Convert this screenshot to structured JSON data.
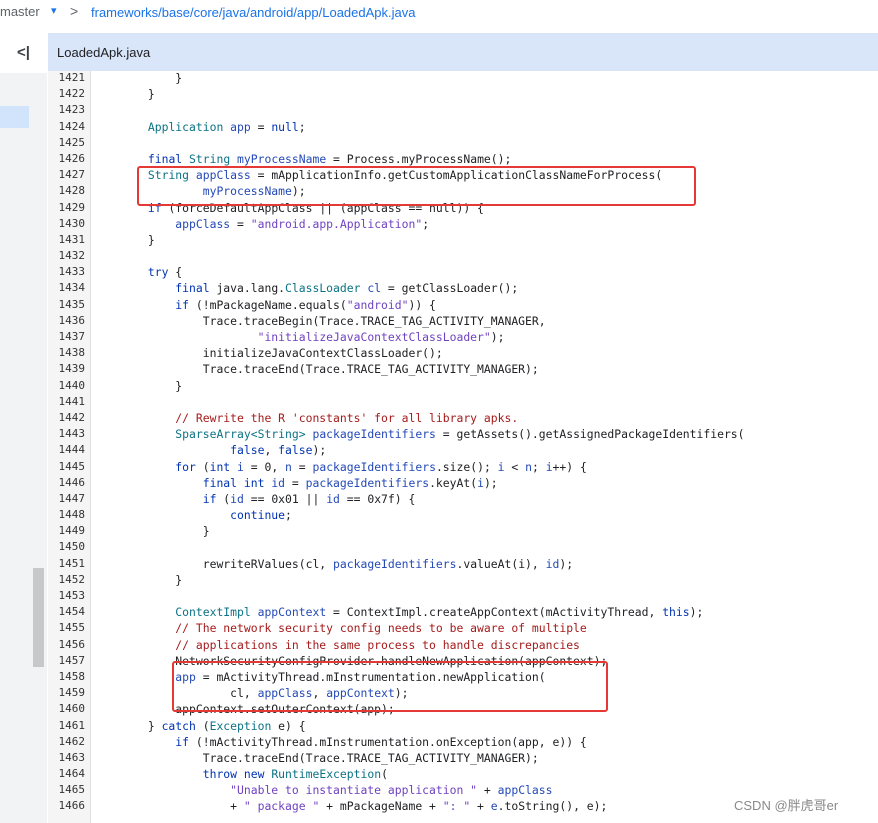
{
  "breadcrumb": {
    "branch": "master",
    "caret": "▾",
    "separator": ">",
    "path": "frameworks/base/core/java/android/app/LoadedApk.java"
  },
  "sidebar": {
    "collapse_icon": "collapse-left-icon",
    "collapse_glyph": "<|"
  },
  "tab": {
    "label": "LoadedApk.java"
  },
  "watermark": "CSDN @胖虎哥er",
  "highlight_color": "#e53935",
  "code_lines": [
    {
      "n": "1421",
      "s": [
        [
          "",
          "            }"
        ]
      ]
    },
    {
      "n": "1422",
      "s": [
        [
          "",
          "        }"
        ]
      ]
    },
    {
      "n": "1423",
      "s": []
    },
    {
      "n": "1424",
      "s": [
        [
          "",
          "        "
        ],
        [
          "ty",
          "Application"
        ],
        [
          "",
          " "
        ],
        [
          "var",
          "app"
        ],
        [
          "",
          " = "
        ],
        [
          "kw",
          "null"
        ],
        [
          "",
          ";"
        ]
      ]
    },
    {
      "n": "1425",
      "s": []
    },
    {
      "n": "1426",
      "s": [
        [
          "",
          "        "
        ],
        [
          "kw",
          "final"
        ],
        [
          "",
          " "
        ],
        [
          "ty",
          "String"
        ],
        [
          "",
          " "
        ],
        [
          "var",
          "myProcessName"
        ],
        [
          "",
          " = Process.myProcessName();"
        ]
      ]
    },
    {
      "n": "1427",
      "s": [
        [
          "",
          "        "
        ],
        [
          "ty",
          "String"
        ],
        [
          "",
          " "
        ],
        [
          "var",
          "appClass"
        ],
        [
          "",
          " = mApplicationInfo.getCustomApplicationClassNameForProcess("
        ]
      ]
    },
    {
      "n": "1428",
      "s": [
        [
          "",
          "                "
        ],
        [
          "var",
          "myProcessName"
        ],
        [
          "",
          ");"
        ]
      ]
    },
    {
      "n": "1429",
      "s": [
        [
          "",
          "        "
        ],
        [
          "kw",
          "if"
        ],
        [
          "",
          " (forceDefaultAppClass || (appClass == null)) {"
        ]
      ]
    },
    {
      "n": "1430",
      "s": [
        [
          "",
          "            "
        ],
        [
          "var",
          "appClass"
        ],
        [
          "",
          " = "
        ],
        [
          "str",
          "\"android.app.Application\""
        ],
        [
          "",
          ";"
        ]
      ]
    },
    {
      "n": "1431",
      "s": [
        [
          "",
          "        }"
        ]
      ]
    },
    {
      "n": "1432",
      "s": []
    },
    {
      "n": "1433",
      "s": [
        [
          "",
          "        "
        ],
        [
          "kw",
          "try"
        ],
        [
          "",
          " {"
        ]
      ]
    },
    {
      "n": "1434",
      "s": [
        [
          "",
          "            "
        ],
        [
          "kw",
          "final"
        ],
        [
          "",
          " java.lang."
        ],
        [
          "ty",
          "ClassLoader"
        ],
        [
          "",
          " "
        ],
        [
          "var",
          "cl"
        ],
        [
          "",
          " = getClassLoader();"
        ]
      ]
    },
    {
      "n": "1435",
      "s": [
        [
          "",
          "            "
        ],
        [
          "kw",
          "if"
        ],
        [
          "",
          " (!mPackageName.equals("
        ],
        [
          "str",
          "\"android\""
        ],
        [
          "",
          ")) {"
        ]
      ]
    },
    {
      "n": "1436",
      "s": [
        [
          "",
          "                Trace.traceBegin(Trace.TRACE_TAG_ACTIVITY_MANAGER,"
        ]
      ]
    },
    {
      "n": "1437",
      "s": [
        [
          "",
          "                        "
        ],
        [
          "str",
          "\"initializeJavaContextClassLoader\""
        ],
        [
          "",
          ");"
        ]
      ]
    },
    {
      "n": "1438",
      "s": [
        [
          "",
          "                initializeJavaContextClassLoader();"
        ]
      ]
    },
    {
      "n": "1439",
      "s": [
        [
          "",
          "                Trace.traceEnd(Trace.TRACE_TAG_ACTIVITY_MANAGER);"
        ]
      ]
    },
    {
      "n": "1440",
      "s": [
        [
          "",
          "            }"
        ]
      ]
    },
    {
      "n": "1441",
      "s": []
    },
    {
      "n": "1442",
      "s": [
        [
          "",
          "            "
        ],
        [
          "cm",
          "// Rewrite the R 'constants' for all library apks."
        ]
      ]
    },
    {
      "n": "1443",
      "s": [
        [
          "",
          "            "
        ],
        [
          "ty",
          "SparseArray<String>"
        ],
        [
          "",
          " "
        ],
        [
          "var",
          "packageIdentifiers"
        ],
        [
          "",
          " = getAssets().getAssignedPackageIdentifiers("
        ]
      ]
    },
    {
      "n": "1444",
      "s": [
        [
          "",
          "                    "
        ],
        [
          "kw",
          "false"
        ],
        [
          "",
          ", "
        ],
        [
          "kw",
          "false"
        ],
        [
          "",
          ");"
        ]
      ]
    },
    {
      "n": "1445",
      "s": [
        [
          "",
          "            "
        ],
        [
          "kw",
          "for"
        ],
        [
          "",
          " ("
        ],
        [
          "kw",
          "int"
        ],
        [
          "",
          " "
        ],
        [
          "var",
          "i"
        ],
        [
          "",
          " = 0, "
        ],
        [
          "var",
          "n"
        ],
        [
          "",
          " = "
        ],
        [
          "var",
          "packageIdentifiers"
        ],
        [
          "",
          ".size(); "
        ],
        [
          "var",
          "i"
        ],
        [
          "",
          " < "
        ],
        [
          "var",
          "n"
        ],
        [
          "",
          "; "
        ],
        [
          "var",
          "i"
        ],
        [
          "",
          "++) {"
        ]
      ]
    },
    {
      "n": "1446",
      "s": [
        [
          "",
          "                "
        ],
        [
          "kw",
          "final"
        ],
        [
          "",
          " "
        ],
        [
          "kw",
          "int"
        ],
        [
          "",
          " "
        ],
        [
          "var",
          "id"
        ],
        [
          "",
          " = "
        ],
        [
          "var",
          "packageIdentifiers"
        ],
        [
          "",
          ".keyAt("
        ],
        [
          "var",
          "i"
        ],
        [
          "",
          ");"
        ]
      ]
    },
    {
      "n": "1447",
      "s": [
        [
          "",
          "                "
        ],
        [
          "kw",
          "if"
        ],
        [
          "",
          " ("
        ],
        [
          "var",
          "id"
        ],
        [
          "",
          " == 0x01 || "
        ],
        [
          "var",
          "id"
        ],
        [
          "",
          " == 0x7f) {"
        ]
      ]
    },
    {
      "n": "1448",
      "s": [
        [
          "",
          "                    "
        ],
        [
          "kw",
          "continue"
        ],
        [
          "",
          ";"
        ]
      ]
    },
    {
      "n": "1449",
      "s": [
        [
          "",
          "                }"
        ]
      ]
    },
    {
      "n": "1450",
      "s": []
    },
    {
      "n": "1451",
      "s": [
        [
          "",
          "                rewriteRValues(cl, "
        ],
        [
          "var",
          "packageIdentifiers"
        ],
        [
          "",
          ".valueAt(i), "
        ],
        [
          "var",
          "id"
        ],
        [
          "",
          ");"
        ]
      ]
    },
    {
      "n": "1452",
      "s": [
        [
          "",
          "            }"
        ]
      ]
    },
    {
      "n": "1453",
      "s": []
    },
    {
      "n": "1454",
      "s": [
        [
          "",
          "            "
        ],
        [
          "ty",
          "ContextImpl"
        ],
        [
          "",
          " "
        ],
        [
          "var",
          "appContext"
        ],
        [
          "",
          " = ContextImpl.createAppContext(mActivityThread, "
        ],
        [
          "kw",
          "this"
        ],
        [
          "",
          ");"
        ]
      ]
    },
    {
      "n": "1455",
      "s": [
        [
          "",
          "            "
        ],
        [
          "cm",
          "// The network security config needs to be aware of multiple"
        ]
      ]
    },
    {
      "n": "1456",
      "s": [
        [
          "",
          "            "
        ],
        [
          "cm",
          "// applications in the same process to handle discrepancies"
        ]
      ]
    },
    {
      "n": "1457",
      "s": [
        [
          "",
          "            NetworkSecurityConfigProvider.handleNewApplication(appContext);"
        ]
      ]
    },
    {
      "n": "1458",
      "s": [
        [
          "",
          "            "
        ],
        [
          "var",
          "app"
        ],
        [
          "",
          " = mActivityThread.mInstrumentation.newApplication("
        ]
      ]
    },
    {
      "n": "1459",
      "s": [
        [
          "",
          "                    cl, "
        ],
        [
          "var",
          "appClass"
        ],
        [
          "",
          ", "
        ],
        [
          "var",
          "appContext"
        ],
        [
          "",
          ");"
        ]
      ]
    },
    {
      "n": "1460",
      "s": [
        [
          "",
          "            appContext.setOuterContext(app);"
        ]
      ]
    },
    {
      "n": "1461",
      "s": [
        [
          "",
          "        } "
        ],
        [
          "kw",
          "catch"
        ],
        [
          "",
          " ("
        ],
        [
          "ty",
          "Exception"
        ],
        [
          "",
          " e) {"
        ]
      ]
    },
    {
      "n": "1462",
      "s": [
        [
          "",
          "            "
        ],
        [
          "kw",
          "if"
        ],
        [
          "",
          " (!mActivityThread.mInstrumentation.onException(app, e)) {"
        ]
      ]
    },
    {
      "n": "1463",
      "s": [
        [
          "",
          "                Trace.traceEnd(Trace.TRACE_TAG_ACTIVITY_MANAGER);"
        ]
      ]
    },
    {
      "n": "1464",
      "s": [
        [
          "",
          "                "
        ],
        [
          "kw",
          "throw"
        ],
        [
          "",
          " "
        ],
        [
          "kw",
          "new"
        ],
        [
          "",
          " "
        ],
        [
          "ty",
          "RuntimeException"
        ],
        [
          "",
          "("
        ]
      ]
    },
    {
      "n": "1465",
      "s": [
        [
          "",
          "                    "
        ],
        [
          "str",
          "\"Unable to instantiate application \""
        ],
        [
          "",
          " + "
        ],
        [
          "var",
          "appClass"
        ]
      ]
    },
    {
      "n": "1466",
      "s": [
        [
          "",
          "                    + "
        ],
        [
          "str",
          "\" package \""
        ],
        [
          "",
          " + mPackageName + "
        ],
        [
          "str",
          "\": \""
        ],
        [
          "",
          " + "
        ],
        [
          "var",
          "e"
        ],
        [
          "",
          ".toString(), e);"
        ]
      ]
    }
  ]
}
